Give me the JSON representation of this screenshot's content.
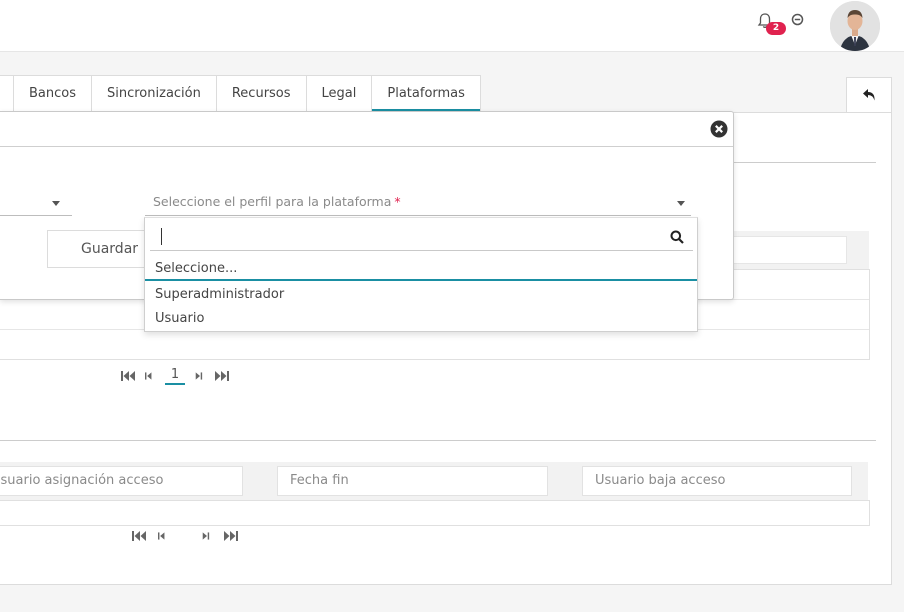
{
  "header": {
    "notification_count": "2",
    "badge_color": "#e0224f"
  },
  "tabs": [
    {
      "label": "Bancos"
    },
    {
      "label": "Sincronización"
    },
    {
      "label": "Recursos"
    },
    {
      "label": "Legal"
    },
    {
      "label": "Plataformas",
      "active": true
    }
  ],
  "modal": {
    "profile_select": {
      "placeholder": "Seleccione el perfil para la plataforma",
      "required_mark": "*"
    },
    "save_label": "Guardar"
  },
  "dropdown": {
    "search_value": "",
    "options": [
      "Seleccione...",
      "Superadministrador",
      "Usuario"
    ],
    "selected_index": 0
  },
  "pagination1": {
    "current_page": "1"
  },
  "table2": {
    "filters": [
      {
        "placeholder": "Usuario asignación acceso"
      },
      {
        "placeholder": "Fecha fin"
      },
      {
        "placeholder": "Usuario baja acceso"
      }
    ]
  },
  "colors": {
    "accent": "#1a8fa3",
    "required": "#e0224f"
  }
}
